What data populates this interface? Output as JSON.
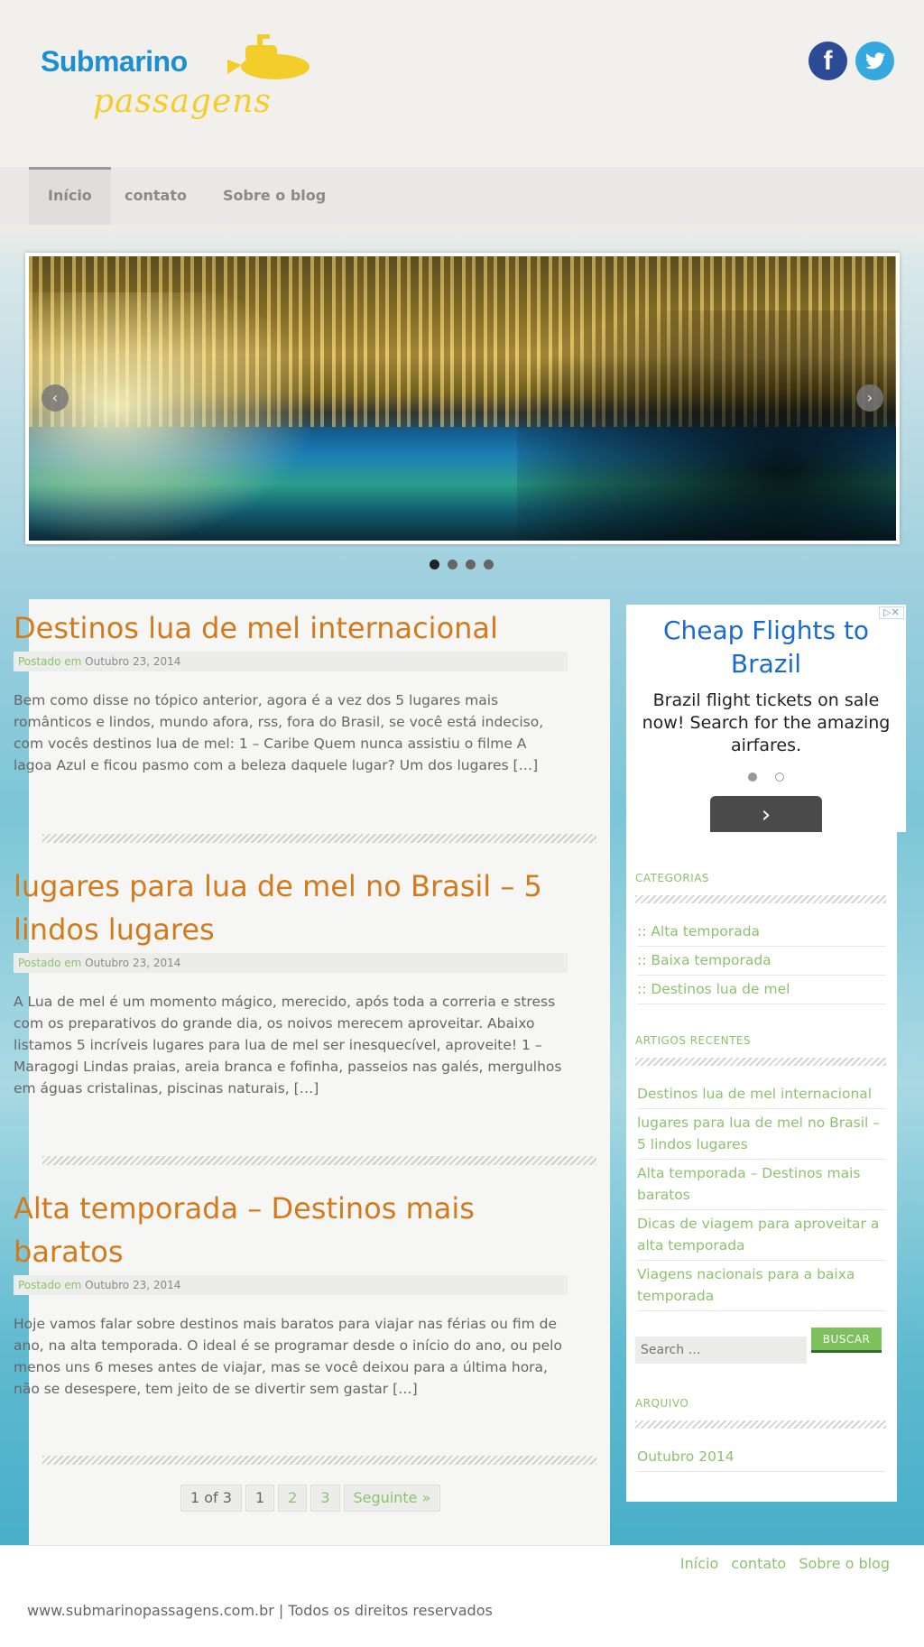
{
  "header": {
    "logo_main": "Submarino",
    "logo_sub": "passagens",
    "social": {
      "facebook_glyph": "f",
      "twitter_glyph": "🐦"
    }
  },
  "nav": {
    "items": [
      "Início",
      "contato",
      "Sobre o blog"
    ],
    "active_index": 0
  },
  "slider": {
    "prev_label": "‹",
    "next_label": "›",
    "slide_count": 4,
    "active_slide": 0
  },
  "posts": [
    {
      "title": "Destinos lua de mel internacional",
      "meta_label": "Postado em",
      "date": "Outubro 23, 2014",
      "excerpt": "Bem como disse no tópico anterior, agora é a vez dos 5 lugares mais românticos e lindos, mundo afora, rss, fora do Brasil, se você está indeciso, com vocês destinos lua de mel: 1 – Caribe Quem nunca assistiu o filme A lagoa Azul e ficou pasmo com a beleza daquele lugar? Um dos lugares […]"
    },
    {
      "title": "lugares para lua de mel no Brasil – 5 lindos lugares",
      "meta_label": "Postado em",
      "date": "Outubro 23, 2014",
      "excerpt": "A Lua de mel é um momento mágico, merecido, após toda a correria e stress com os preparativos do grande dia, os noivos merecem aproveitar. Abaixo listamos 5 incríveis lugares para lua de mel ser inesquecível, aproveite! 1 – Maragogi Lindas praias, areia branca e fofinha, passeios nas galés, mergulhos em águas cristalinas, piscinas naturais, […]"
    },
    {
      "title": "Alta temporada – Destinos mais baratos",
      "meta_label": "Postado em",
      "date": "Outubro 23, 2014",
      "excerpt": "Hoje vamos falar sobre destinos mais baratos para viajar nas férias ou fim de ano, na alta temporada. O ideal é se programar desde o início do ano, ou pelo menos uns 6 meses antes de viajar, mas se você deixou para a última hora, não se desespere, tem jeito de se divertir sem gastar […]"
    }
  ],
  "pagination": {
    "summary": "1 of 3",
    "pages": [
      "1",
      "2",
      "3"
    ],
    "next": "Seguinte »"
  },
  "ad": {
    "close": "▷✕",
    "title": "Cheap Flights to Brazil",
    "body": "Brazil flight tickets on sale now! Search for the amazing airfares.",
    "button": "›"
  },
  "sidebar": {
    "categories_title": "CATEGORIAS",
    "categories": [
      ":: Alta temporada",
      ":: Baixa temporada",
      ":: Destinos lua de mel"
    ],
    "recent_title": "ARTIGOS RECENTES",
    "recent": [
      "Destinos lua de mel internacional",
      "lugares para lua de mel no Brasil – 5 lindos lugares",
      "Alta temporada – Destinos mais baratos",
      "Dicas de viagem para aproveitar a alta temporada",
      "Viagens nacionais para a baixa temporada"
    ],
    "search_placeholder": "Search …",
    "search_button": "BUSCAR",
    "archive_title": "ARQUIVO",
    "archive": [
      "Outubro 2014"
    ]
  },
  "footer": {
    "nav": [
      "Início",
      "contato",
      "Sobre o blog"
    ],
    "copyright": "www.submarinopassagens.com.br | Todos os direitos reservados"
  },
  "colors": {
    "accent_orange": "#d57a1c",
    "accent_green": "#8dc26d",
    "ad_blue": "#1a6ad2",
    "facebook": "#2d4a95",
    "twitter": "#35a9dd"
  }
}
